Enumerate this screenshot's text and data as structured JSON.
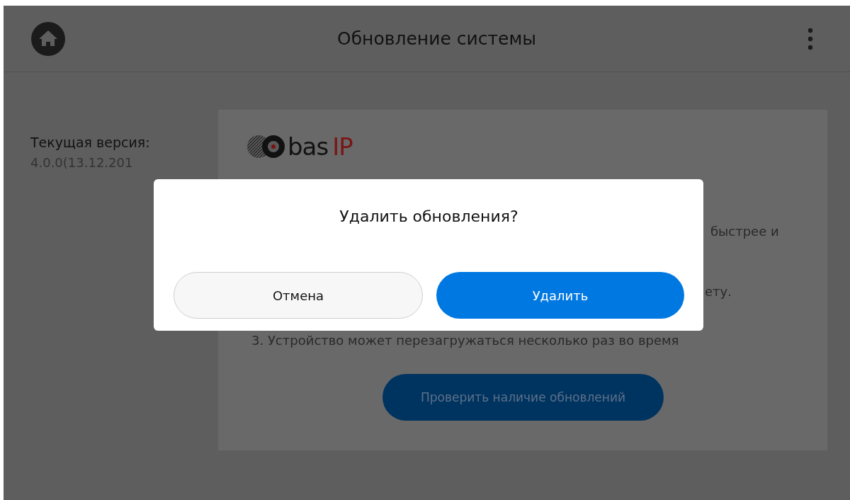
{
  "top_bar": {
    "title": "Обновление системы"
  },
  "version": {
    "label": "Текущая версия:",
    "value": "4.0.0(13.12.201"
  },
  "card": {
    "logo": {
      "text": "bas",
      "accent": "IP"
    },
    "text_fragments": [
      "быстрее и",
      "ету."
    ],
    "note": "3. Устройство может перезагружаться несколько раз во время",
    "button": "Проверить наличие обновлений"
  },
  "dialog": {
    "title": "Удалить обновления?",
    "buttons": [
      {
        "label": "Отмена",
        "kind": "secondary"
      },
      {
        "label": "Удалить",
        "kind": "primary"
      }
    ]
  }
}
